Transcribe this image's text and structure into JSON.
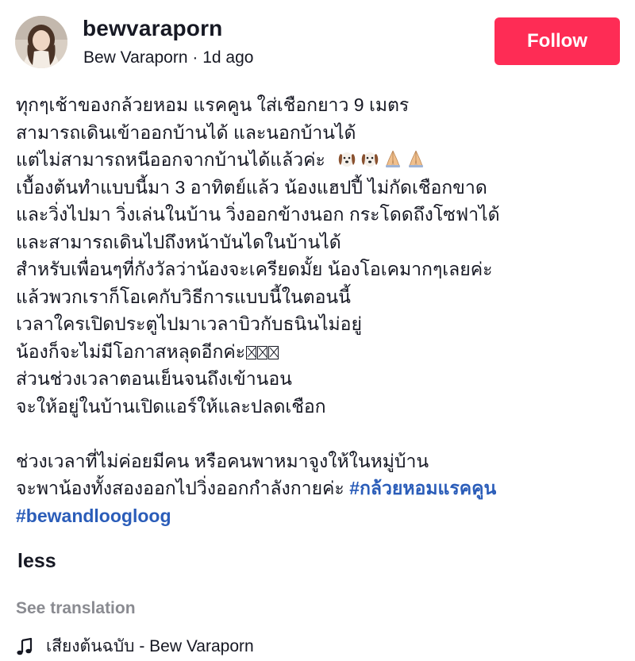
{
  "post": {
    "username": "bewvaraporn",
    "display_name": "Bew Varaporn",
    "separator": " · ",
    "time_ago": "1d ago",
    "follow_label": "Follow"
  },
  "caption": {
    "lines": [
      "ทุกๆเช้าของกล้วยหอม แรคคูน ใส่เชือกยาว 9 เมตร",
      "สามารถเดินเข้าออกบ้านได้ และนอกบ้านได้",
      "แต่ไม่สามารถหนีออกจากบ้านได้แล้วค่ะ",
      "เบื้องต้นทำแบบนี้มา 3 อาทิตย์แล้ว น้องแฮปปี้ ไม่กัดเชือกขาด",
      "และวิ่งไปมา วิ่งเล่นในบ้าน วิ่งออกข้างนอก กระโดดถึงโซฟาได้",
      "และสามารถเดินไปถึงหน้าบันไดในบ้านได้",
      "สำหรับเพื่อนๆที่กังวัลว่าน้องจะเครียดมั้ย น้องโอเคมากๆเลยค่ะ",
      "แล้วพวกเราก็โอเคกับวิธีการแบบนี้ในตอนนี้",
      "เวลาใครเปิดประตูไปมาเวลาบิวกับธนินไม่อยู่",
      "น้องก็จะไม่มีโอกาสหลุดอีกค่ะ",
      "ส่วนช่วงเวลาตอนเย็นจนถึงเข้านอน",
      "จะให้อยู่ในบ้านเปิดแอร์ให้และปลดเชือก",
      "",
      "ช่วงเวลาที่ไม่ค่อยมีคน หรือคนพาหมาจูงให้ในหมู่บ้าน",
      "จะพาน้องทั้งสองออกไปวิ่งออกกำลังกายค่ะ "
    ],
    "hashtags": [
      "#กล้วยหอมแรคคูน",
      "#bewandloogloog"
    ],
    "emoji_icons": [
      "dog-face-icon",
      "dog-face-icon",
      "folded-hands-icon",
      "folded-hands-icon"
    ],
    "hashtag_color": "#2b5db9"
  },
  "controls": {
    "less_label": "less",
    "see_translation_label": "See translation",
    "music_label": "เสียงต้นฉบับ - Bew Varaporn"
  },
  "colors": {
    "follow_button": "#fe2c55",
    "muted_text": "#8a8b91"
  }
}
